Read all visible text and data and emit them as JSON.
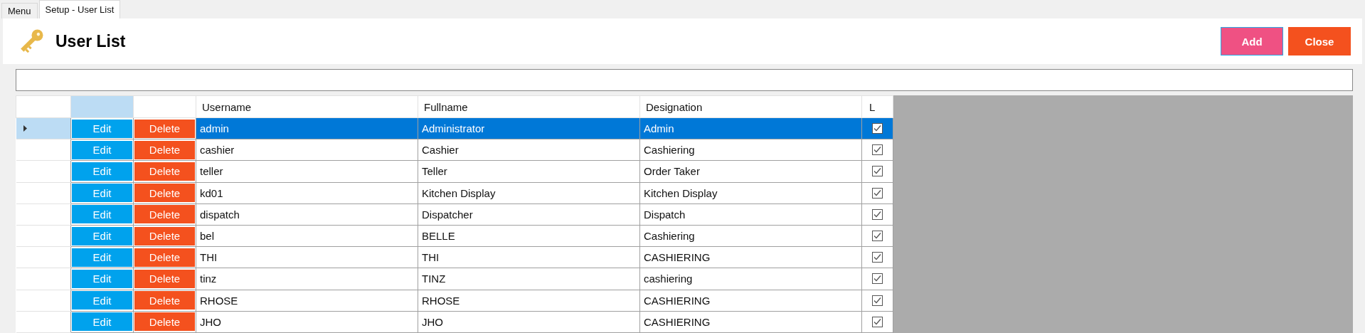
{
  "tabs": [
    {
      "label": "Menu",
      "selected": false
    },
    {
      "label": "Setup - User List",
      "selected": true
    }
  ],
  "header": {
    "title": "User List",
    "buttons": [
      {
        "label": "Add",
        "kind": "add"
      },
      {
        "label": "Close",
        "kind": "close"
      }
    ]
  },
  "table": {
    "columns": [
      "Username",
      "Fullname",
      "Designation",
      "L"
    ],
    "rows": [
      {
        "edit": "Edit",
        "delete": "Delete",
        "username": "admin",
        "fullname": "Administrator",
        "designation": "Admin",
        "checked": true,
        "selected": true
      },
      {
        "edit": "Edit",
        "delete": "Delete",
        "username": "cashier",
        "fullname": "Cashier",
        "designation": "Cashiering",
        "checked": true,
        "selected": false
      },
      {
        "edit": "Edit",
        "delete": "Delete",
        "username": "teller",
        "fullname": "Teller",
        "designation": "Order Taker",
        "checked": true,
        "selected": false
      },
      {
        "edit": "Edit",
        "delete": "Delete",
        "username": "kd01",
        "fullname": "Kitchen Display",
        "designation": "Kitchen Display",
        "checked": true,
        "selected": false
      },
      {
        "edit": "Edit",
        "delete": "Delete",
        "username": "dispatch",
        "fullname": "Dispatcher",
        "designation": "Dispatch",
        "checked": true,
        "selected": false
      },
      {
        "edit": "Edit",
        "delete": "Delete",
        "username": "bel",
        "fullname": "BELLE",
        "designation": "Cashiering",
        "checked": true,
        "selected": false
      },
      {
        "edit": "Edit",
        "delete": "Delete",
        "username": "THI",
        "fullname": "THI",
        "designation": "CASHIERING",
        "checked": true,
        "selected": false
      },
      {
        "edit": "Edit",
        "delete": "Delete",
        "username": "tinz",
        "fullname": "TINZ",
        "designation": "cashiering",
        "checked": true,
        "selected": false
      },
      {
        "edit": "Edit",
        "delete": "Delete",
        "username": "RHOSE",
        "fullname": "RHOSE",
        "designation": "CASHIERING",
        "checked": true,
        "selected": false
      },
      {
        "edit": "Edit",
        "delete": "Delete",
        "username": "JHO",
        "fullname": "JHO",
        "designation": "CASHIERING",
        "checked": true,
        "selected": false
      }
    ]
  }
}
